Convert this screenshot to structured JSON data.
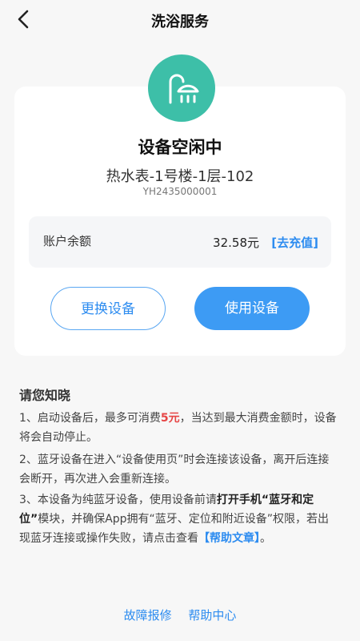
{
  "header": {
    "title": "洗浴服务"
  },
  "device": {
    "status": "设备空闲中",
    "name": "热水表-1号楼-1层-102",
    "code": "YH2435000001",
    "icon": "shower-icon",
    "icon_bg": "#3dbfa8"
  },
  "account": {
    "label": "账户余额",
    "balance": "32.58元",
    "recharge_label": "[去充值]"
  },
  "actions": {
    "change_label": "更换设备",
    "use_label": "使用设备"
  },
  "notice": {
    "title": "请您知晓",
    "item1_before": "1、启动设备后，最多可消费",
    "item1_amount": "5元",
    "item1_after": "，当达到最大消费金额时，设备将会自动停止。",
    "item2": "2、蓝牙设备在进入“设备使用页”时会连接该设备，离开后连接会断开，再次进入会重新连接。",
    "item3_a": "3、本设备为纯蓝牙设备，使用设备前请",
    "item3_b": "打开手机“蓝牙和定位”",
    "item3_c": "模块，并确保App拥有“蓝牙、定位和附近设备”权限，若出现蓝牙连接或操作失败，请点击查看",
    "item3_link": "【帮助文章】",
    "item3_end": "。"
  },
  "footer": {
    "report_label": "故障报修",
    "help_label": "帮助中心"
  },
  "colors": {
    "accent": "#3d9bf4",
    "link": "#2d8cf0",
    "highlight": "#e64545"
  }
}
